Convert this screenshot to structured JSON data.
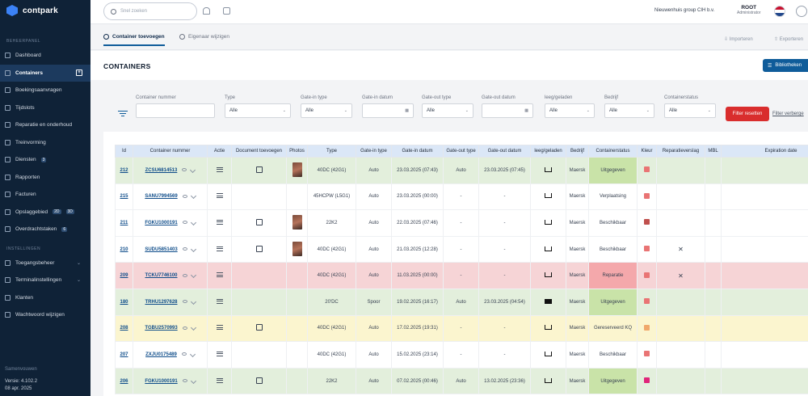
{
  "app": {
    "logo_text": "contpark"
  },
  "sidebar": {
    "section_main": "BEHEERPANEL",
    "items": [
      {
        "label": "Dashboard",
        "icon": "home-icon",
        "active": false
      },
      {
        "label": "Containers",
        "icon": "container-icon",
        "active": true,
        "plus": true
      },
      {
        "label": "Boekingsaanvragen",
        "icon": "calendar-icon",
        "active": false
      },
      {
        "label": "Tijdslots",
        "icon": "clock-icon",
        "active": false
      },
      {
        "label": "Reparatie en onderhoud",
        "icon": "wrench-icon",
        "active": false
      },
      {
        "label": "Treinvorming",
        "icon": "train-icon",
        "active": false
      },
      {
        "label": "Diensten",
        "icon": "services-icon",
        "active": false,
        "badge": "3"
      },
      {
        "label": "Rapporten",
        "icon": "report-icon",
        "active": false
      },
      {
        "label": "Facturen",
        "icon": "invoice-icon",
        "active": false
      },
      {
        "label": "Opslaggebied",
        "icon": "storage-icon",
        "active": false,
        "badges": [
          "2D",
          "3D"
        ]
      },
      {
        "label": "Overdrachtstaken",
        "icon": "transfer-icon",
        "active": false,
        "badge": "6"
      }
    ],
    "section_settings": "INSTELLINGEN",
    "settings_items": [
      {
        "label": "Toegangsbeheer",
        "icon": "access-icon",
        "chevron": true
      },
      {
        "label": "Terminalinstellingen",
        "icon": "terminal-icon",
        "chevron": true
      },
      {
        "label": "Klanten",
        "icon": "customers-icon",
        "chevron": false
      },
      {
        "label": "Wachtwoord wijzigen",
        "icon": "key-icon",
        "chevron": false
      }
    ],
    "collapse_label": "Samenvouwen",
    "version": "Versie: 4.102.2",
    "date": "08 apr. 2025"
  },
  "topbar": {
    "search_placeholder": "Snel zoeken",
    "company": "Nieuwenhuis group CIH b.v.",
    "user_name": "ROOT",
    "user_role": "Administrator"
  },
  "tabs": {
    "add_container": "Container toevoegen",
    "owner_change": "Eigenaar wijzigen",
    "import": "Importeren",
    "export": "Exporteren"
  },
  "page": {
    "title": "CONTAINERS",
    "library_button": "Bibliotheken"
  },
  "filters": {
    "fields": [
      {
        "label": "Container nummer",
        "value": "",
        "dropdown": false
      },
      {
        "label": "Type",
        "value": "Alle",
        "dropdown": true
      },
      {
        "label": "Gate-in type",
        "value": "Alle",
        "dropdown": true
      },
      {
        "label": "Gate-in datum",
        "value": "",
        "dropdown": false,
        "calendar": true
      },
      {
        "label": "Gate-out type",
        "value": "Alle",
        "dropdown": true
      },
      {
        "label": "Gate-out datum",
        "value": "",
        "dropdown": false,
        "calendar": true
      },
      {
        "label": "leeg/geladen",
        "value": "Alle",
        "dropdown": true
      },
      {
        "label": "Bedrijf",
        "value": "Alle",
        "dropdown": true
      },
      {
        "label": "Containerstatus",
        "value": "Alle",
        "dropdown": true
      }
    ],
    "reset_button": "Filter resetten",
    "advanced_link": "Filter verberge"
  },
  "table": {
    "headers": [
      "Id",
      "Container nummer",
      "Actie",
      "Document toevoegen",
      "Photos",
      "Type",
      "Gate-in type",
      "Gate-in datum",
      "Gate-out type",
      "Gate-out datum",
      "leeg/geladen",
      "Bedrijf",
      "Containerstatus",
      "Kleur",
      "Reparatieverslag",
      "MBL",
      "Expiration date"
    ],
    "rows": [
      {
        "id": "212",
        "number": "ZCSU6814513",
        "doc": true,
        "photo": true,
        "type": "40DC (42G1)",
        "gate_in_type": "Auto",
        "gate_in_date": "23.03.2025 (07:43)",
        "gate_out_type": "Auto",
        "gate_out_date": "23.03.2025 (07:45)",
        "load": "empty",
        "company": "Maersk",
        "status": "Uitgegeven",
        "status_tone": "green",
        "color": "#e97474",
        "repair": false,
        "row_tone": "green"
      },
      {
        "id": "215",
        "number": "SANU7994569",
        "doc": false,
        "photo": false,
        "type": "45HCPW (L5G1)",
        "gate_in_type": "Auto",
        "gate_in_date": "23.03.2025 (00:00)",
        "gate_out_type": "-",
        "gate_out_date": "-",
        "load": "empty",
        "company": "Maersk",
        "status": "Verplaatsing",
        "status_tone": "none",
        "color": "#e97474",
        "repair": false,
        "row_tone": "white"
      },
      {
        "id": "211",
        "number": "FGKU1000191",
        "doc": true,
        "photo": true,
        "type": "22K2",
        "gate_in_type": "Auto",
        "gate_in_date": "22.03.2025 (07:46)",
        "gate_out_type": "-",
        "gate_out_date": "-",
        "load": "empty",
        "company": "Maersk",
        "status": "Beschikbaar",
        "status_tone": "none",
        "color": "#c0504d",
        "repair": false,
        "row_tone": "white"
      },
      {
        "id": "210",
        "number": "SUDU5851403",
        "doc": true,
        "photo": true,
        "type": "40DC (42G1)",
        "gate_in_type": "Auto",
        "gate_in_date": "21.03.2025 (12:28)",
        "gate_out_type": "-",
        "gate_out_date": "-",
        "load": "empty",
        "company": "Maersk",
        "status": "Beschikbaar",
        "status_tone": "none",
        "color": "#e97474",
        "repair": true,
        "row_tone": "white"
      },
      {
        "id": "209",
        "number": "TCKU7746100",
        "doc": false,
        "photo": false,
        "type": "40DC (42G1)",
        "gate_in_type": "Auto",
        "gate_in_date": "11.03.2025 (00:00)",
        "gate_out_type": "-",
        "gate_out_date": "-",
        "load": "empty",
        "company": "Maersk",
        "status": "Reparatie",
        "status_tone": "red",
        "color": "#e97474",
        "repair": true,
        "row_tone": "red"
      },
      {
        "id": "180",
        "number": "TRHU1297628",
        "doc": false,
        "photo": false,
        "type": "20'DC",
        "gate_in_type": "Spoor",
        "gate_in_date": "19.02.2025 (16:17)",
        "gate_out_type": "Auto",
        "gate_out_date": "23.03.2025 (04:54)",
        "load": "full",
        "company": "Maersk",
        "status": "Uitgegeven",
        "status_tone": "green",
        "color": "#e97474",
        "repair": false,
        "row_tone": "green"
      },
      {
        "id": "208",
        "number": "TGBU2570993",
        "doc": true,
        "photo": false,
        "type": "40DC (42G1)",
        "gate_in_type": "Auto",
        "gate_in_date": "17.02.2025 (19:31)",
        "gate_out_type": "-",
        "gate_out_date": "-",
        "load": "empty",
        "company": "Maersk",
        "status": "Gereserveerd KQ",
        "status_tone": "none",
        "color": "#f0a86b",
        "repair": false,
        "row_tone": "yellow"
      },
      {
        "id": "207",
        "number": "ZXJU0175489",
        "doc": false,
        "photo": false,
        "type": "40DC (42G1)",
        "gate_in_type": "Auto",
        "gate_in_date": "15.02.2025 (23:14)",
        "gate_out_type": "-",
        "gate_out_date": "-",
        "load": "empty",
        "company": "Maersk",
        "status": "Beschikbaar",
        "status_tone": "none",
        "color": "#e97474",
        "repair": false,
        "row_tone": "white"
      },
      {
        "id": "206",
        "number": "FGKU1000191",
        "doc": true,
        "photo": false,
        "type": "22K2",
        "gate_in_type": "Auto",
        "gate_in_date": "07.02.2025 (00:46)",
        "gate_out_type": "Auto",
        "gate_out_date": "13.02.2025 (23:36)",
        "load": "empty",
        "company": "Maersk",
        "status": "Uitgegeven",
        "status_tone": "green",
        "color": "#e0267a",
        "repair": false,
        "row_tone": "green"
      }
    ]
  }
}
